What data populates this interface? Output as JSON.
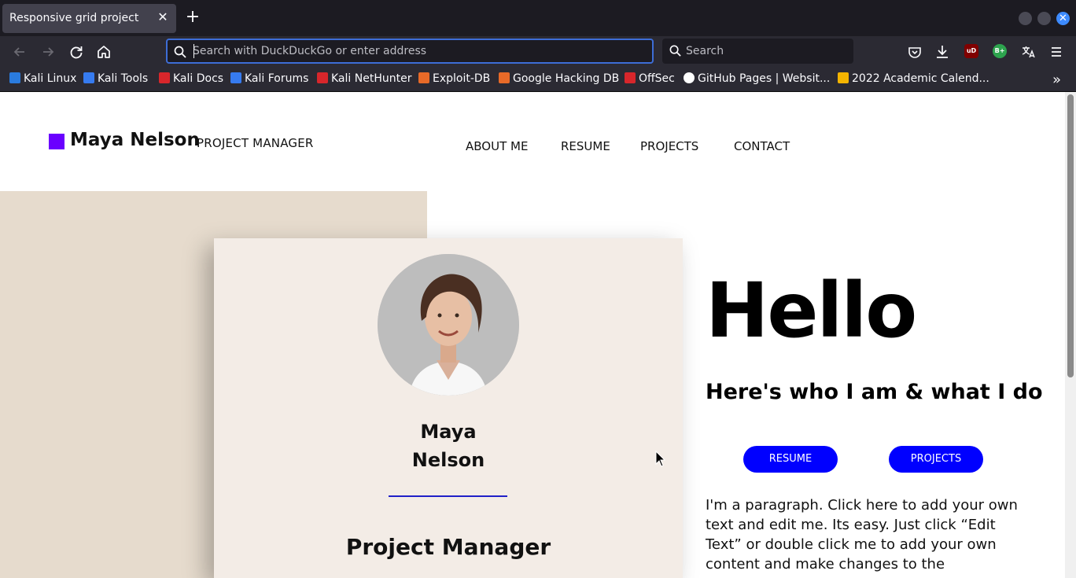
{
  "browser": {
    "tab_title": "Responsive grid project",
    "tab_close": "✕",
    "new_tab": "+",
    "url_placeholder": "Search with DuckDuckGo or enter address",
    "search_placeholder": "Search",
    "extension_badges": [
      "uD",
      "B+"
    ],
    "bookmarks": [
      {
        "label": "Kali Linux",
        "color": "#2a7bde"
      },
      {
        "label": "Kali Tools",
        "color": "#367bf0"
      },
      {
        "label": "Kali Docs",
        "color": "#d8262b"
      },
      {
        "label": "Kali Forums",
        "color": "#367bf0"
      },
      {
        "label": "Kali NetHunter",
        "color": "#d8262b"
      },
      {
        "label": "Exploit-DB",
        "color": "#e86a28"
      },
      {
        "label": "Google Hacking DB",
        "color": "#e86a28"
      },
      {
        "label": "OffSec",
        "color": "#d8262b"
      },
      {
        "label": "GitHub Pages | Websit...",
        "color": "#ffffff"
      },
      {
        "label": "2022 Academic Calend...",
        "color": "#f4b400"
      }
    ],
    "bookmarks_more": "»"
  },
  "site": {
    "logo_name": "Maya Nelson",
    "logo_role": "PROJECT MANAGER",
    "brand_color": "#6a00ff",
    "nav": [
      "ABOUT ME",
      "RESUME",
      "PROJECTS",
      "CONTACT"
    ],
    "card": {
      "name": "Maya Nelson",
      "title": "Project Manager"
    },
    "hero": {
      "greeting": "Hello",
      "subheading": "Here's who I am & what I do",
      "buttons": [
        "RESUME",
        "PROJECTS"
      ],
      "button_color": "#0000ff",
      "intro": "I'm a paragraph. Click here to add your own text and edit me. Its easy. Just click “Edit Text” or double click me to add your own content and make changes to the"
    }
  }
}
